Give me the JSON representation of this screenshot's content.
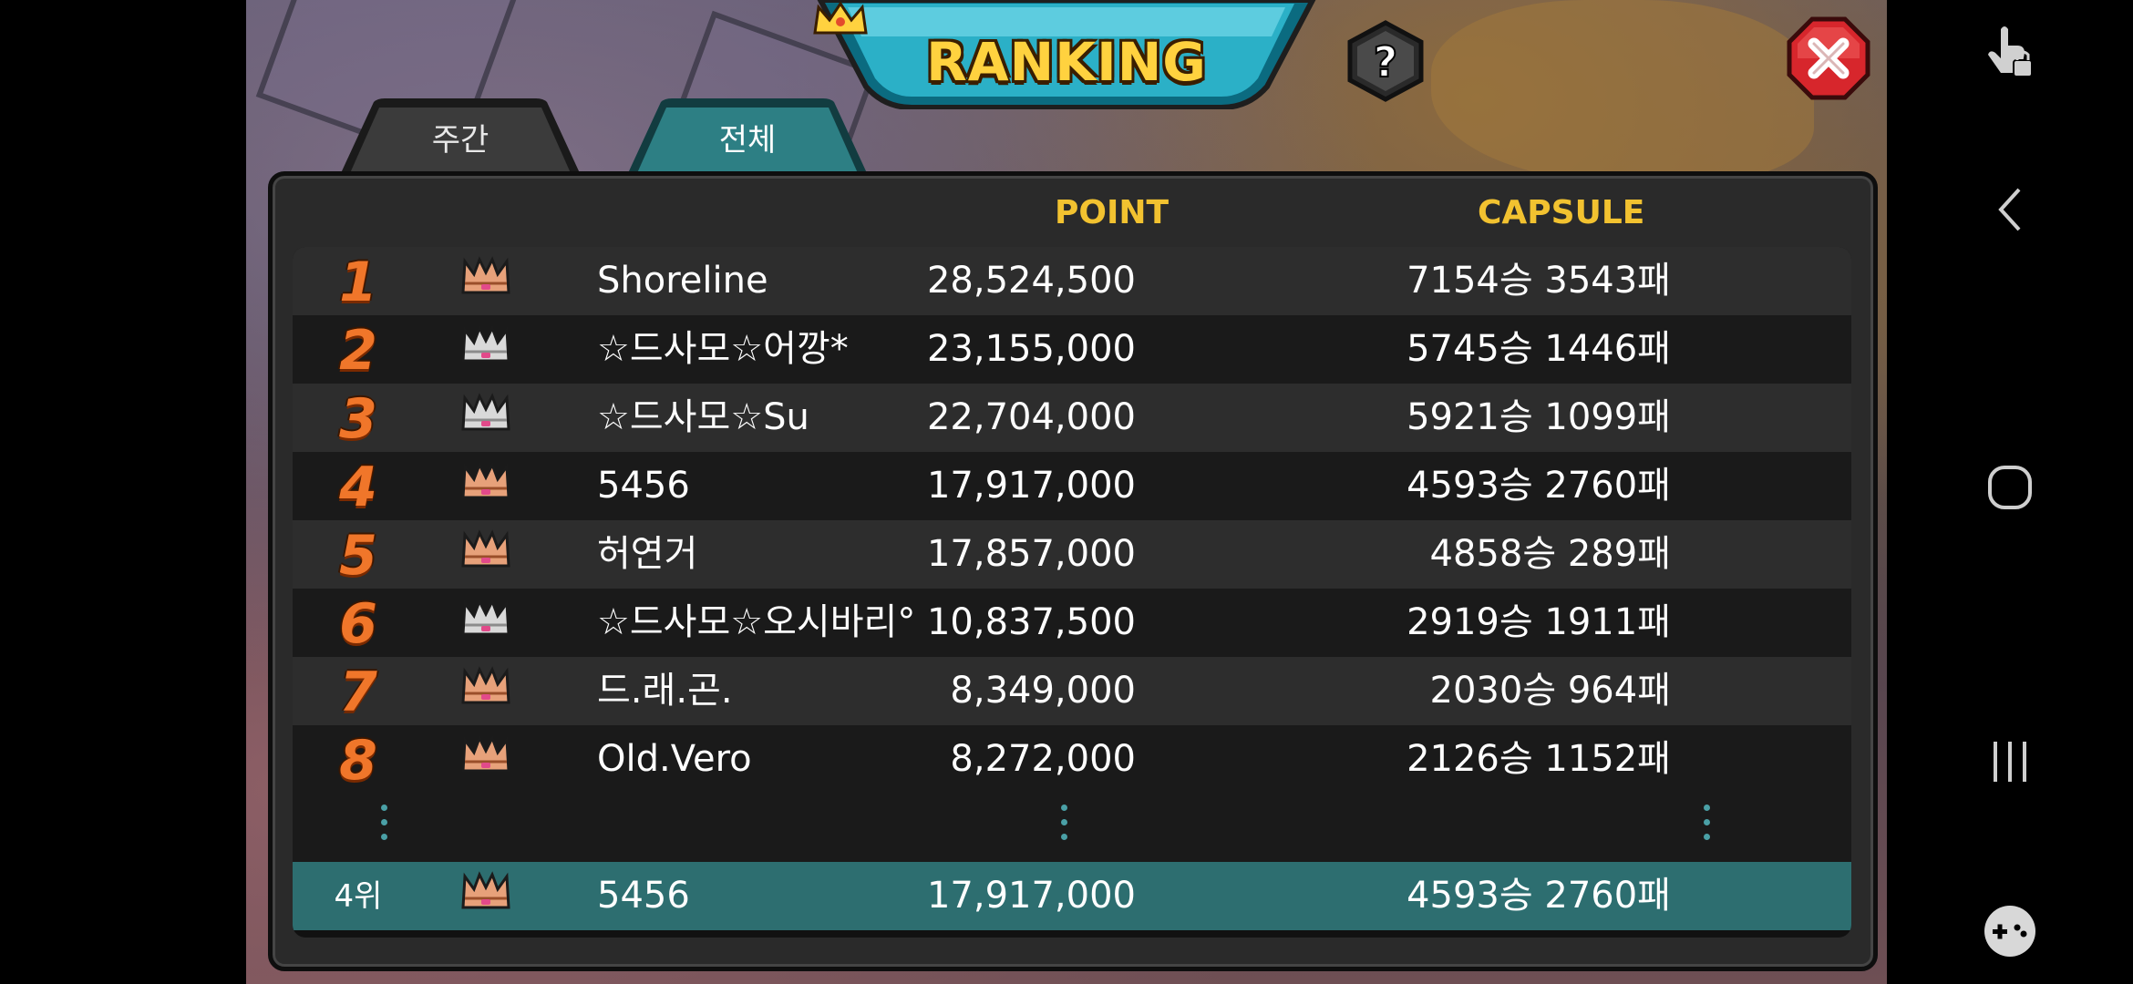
{
  "title": "RANKING",
  "tabs": [
    {
      "label": "주간",
      "active": false
    },
    {
      "label": "전체",
      "active": true
    }
  ],
  "columns": {
    "point": "POINT",
    "capsule": "CAPSULE"
  },
  "rows": [
    {
      "rank": "1",
      "crown": "bronze",
      "name": "Shoreline",
      "point": "28,524,500",
      "capsule": "7154승 3543패"
    },
    {
      "rank": "2",
      "crown": "silver",
      "name": "☆드사모☆어깡*",
      "point": "23,155,000",
      "capsule": "5745승 1446패"
    },
    {
      "rank": "3",
      "crown": "silver",
      "name": "☆드사모☆Su",
      "point": "22,704,000",
      "capsule": "5921승 1099패"
    },
    {
      "rank": "4",
      "crown": "bronze",
      "name": "5456",
      "point": "17,917,000",
      "capsule": "4593승 2760패"
    },
    {
      "rank": "5",
      "crown": "bronze",
      "name": "허연거",
      "point": "17,857,000",
      "capsule": "4858승 289패"
    },
    {
      "rank": "6",
      "crown": "silver",
      "name": "☆드사모☆오시바리°",
      "point": "10,837,500",
      "capsule": "2919승 1911패"
    },
    {
      "rank": "7",
      "crown": "bronze",
      "name": "드.래.곤.",
      "point": "8,349,000",
      "capsule": "2030승 964패"
    },
    {
      "rank": "8",
      "crown": "bronze",
      "name": "Old.Vero",
      "point": "8,272,000",
      "capsule": "2126승 1152패"
    }
  ],
  "my_rank": {
    "rank": "4위",
    "crown": "bronze",
    "name": "5456",
    "point": "17,917,000",
    "capsule": "4593승 2760패"
  },
  "colors": {
    "accent_gold": "#f2c230",
    "rank_orange": "#f0762a",
    "my_row_teal": "#2d6e70",
    "close_red": "#d7262c"
  },
  "icons": {
    "help": "question-mark-icon",
    "close": "close-x-icon",
    "crown": "crown-icon"
  },
  "system_nav": [
    "touch-lock-icon",
    "back-icon",
    "home-icon",
    "recents-icon",
    "game-tools-icon"
  ]
}
